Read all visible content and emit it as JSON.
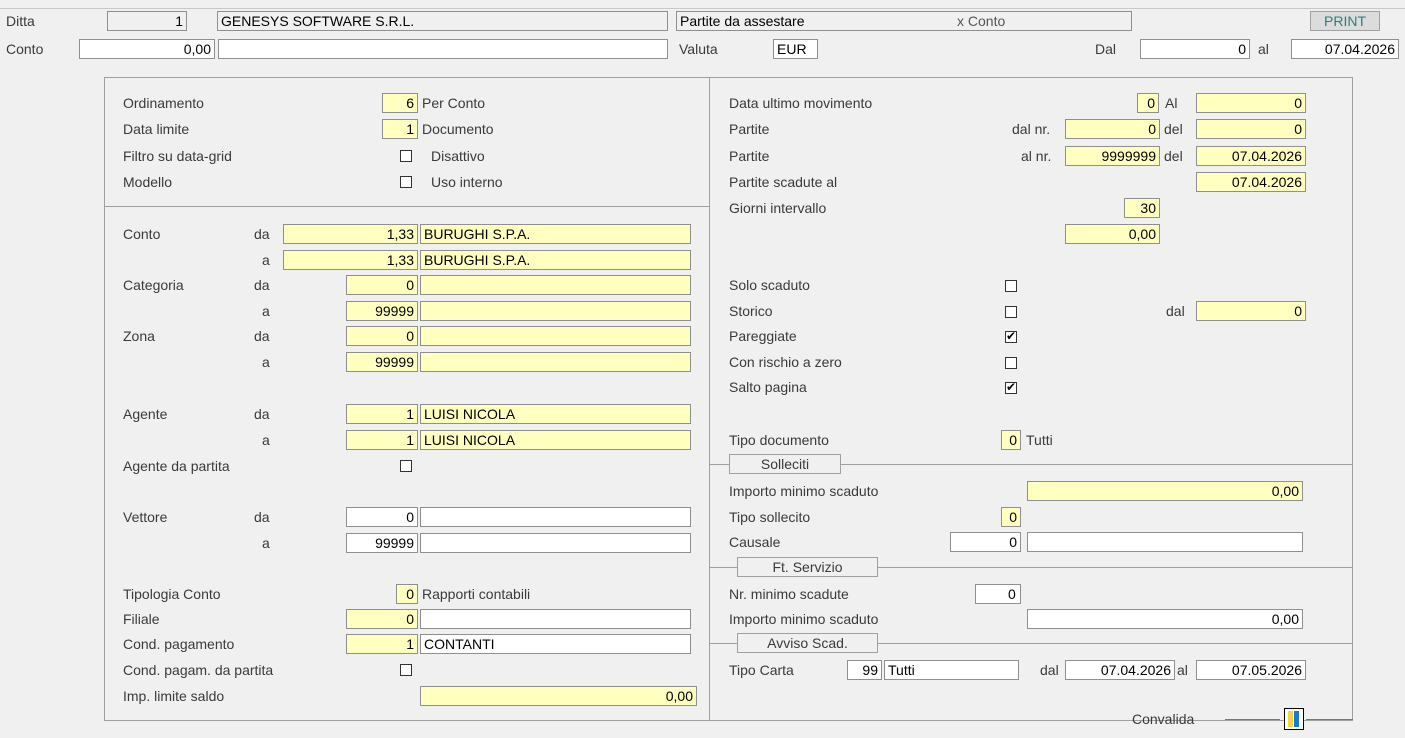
{
  "header": {
    "ditta_label": "Ditta",
    "ditta_code": "1",
    "ditta_name": "GENESYS SOFTWARE S.R.L.",
    "report_title": "Partite da assestare",
    "report_mode": "x Conto",
    "print_label": "PRINT",
    "conto_label": "Conto",
    "conto_value": "0,00",
    "conto_desc": "",
    "valuta_label": "Valuta",
    "valuta_value": "EUR",
    "dal_label": "Dal",
    "dal_value": "0",
    "al_label": "al",
    "al_value": "07.04.2026"
  },
  "left": {
    "ordinamento_label": "Ordinamento",
    "ordinamento_value": "6",
    "ordinamento_desc": "Per Conto",
    "data_limite_label": "Data limite",
    "data_limite_value": "1",
    "data_limite_desc": "Documento",
    "filtro_label": "Filtro su data-grid",
    "filtro_desc": "Disattivo",
    "modello_label": "Modello",
    "modello_desc": "Uso interno",
    "da": "da",
    "a": "a",
    "conto_label": "Conto",
    "conto_from": "1,33",
    "conto_from_name": "BURUGHI S.P.A.",
    "conto_to": "1,33",
    "conto_to_name": "BURUGHI S.P.A.",
    "categoria_label": "Categoria",
    "categoria_from": "0",
    "categoria_from_name": "",
    "categoria_to": "99999",
    "categoria_to_name": "",
    "zona_label": "Zona",
    "zona_from": "0",
    "zona_from_name": "",
    "zona_to": "99999",
    "zona_to_name": "",
    "agente_label": "Agente",
    "agente_from": "1",
    "agente_from_name": "LUISI NICOLA",
    "agente_to": "1",
    "agente_to_name": "LUISI NICOLA",
    "agente_partita_label": "Agente da partita",
    "vettore_label": "Vettore",
    "vettore_from": "0",
    "vettore_from_name": "",
    "vettore_to": "99999",
    "vettore_to_name": "",
    "tipologia_label": "Tipologia Conto",
    "tipologia_value": "0",
    "tipologia_desc": "Rapporti contabili",
    "filiale_label": "Filiale",
    "filiale_value": "0",
    "filiale_name": "",
    "cond_pag_label": "Cond. pagamento",
    "cond_pag_value": "1",
    "cond_pag_name": "CONTANTI",
    "cond_pag_partita_label": "Cond. pagam. da partita",
    "imp_limite_label": "Imp. limite saldo",
    "imp_limite_value": "0,00"
  },
  "right": {
    "data_ultimo_label": "Data ultimo movimento",
    "data_ultimo_value": "0",
    "al_label": "Al",
    "al_value": "0",
    "partite_label": "Partite",
    "dal_nr_label": "dal nr.",
    "dal_nr_value": "0",
    "del_label": "del",
    "del1_value": "0",
    "al_nr_label": "al nr.",
    "al_nr_value": "9999999",
    "del2_value": "07.04.2026",
    "scadute_label": "Partite scadute  al",
    "scadute_value": "07.04.2026",
    "giorni_label": "Giorni intervallo",
    "giorni_value": "30",
    "importo_value": "0,00",
    "solo_scaduto_label": "Solo scaduto",
    "storico_label": "Storico",
    "storico_dal_label": "dal",
    "storico_dal_value": "0",
    "pareggiate_label": "Pareggiate",
    "rischio_label": "Con rischio a zero",
    "salto_label": "Salto pagina",
    "tipo_doc_label": "Tipo documento",
    "tipo_doc_value": "0",
    "tipo_doc_desc": "Tutti",
    "solleciti_legend": "Solleciti",
    "imp_min_label": "Importo minimo scaduto",
    "imp_min_value": "0,00",
    "tipo_sollecito_label": "Tipo sollecito",
    "tipo_sollecito_value": "0",
    "causale_label": "Causale",
    "causale_value": "0",
    "causale_desc": "",
    "ft_legend": "Ft. Servizio",
    "nr_min_label": "Nr. minimo scadute",
    "nr_min_value": "0",
    "imp_min2_label": "Importo minimo scaduto",
    "imp_min2_value": "0,00",
    "avviso_legend": "Avviso Scad.",
    "tipo_carta_label": "Tipo Carta",
    "tipo_carta_value": "99",
    "tipo_carta_desc": "Tutti",
    "carta_dal_label": "dal",
    "carta_dal_value": "07.04.2026",
    "carta_al_label": "al",
    "carta_al_value": "07.05.2026",
    "convalida_label": "Convalida"
  },
  "checkboxes": {
    "filtro": false,
    "modello": false,
    "agente_partita": false,
    "cond_pag_partita": false,
    "solo_scaduto": false,
    "storico": false,
    "pareggiate": true,
    "rischio": false,
    "salto": true
  }
}
